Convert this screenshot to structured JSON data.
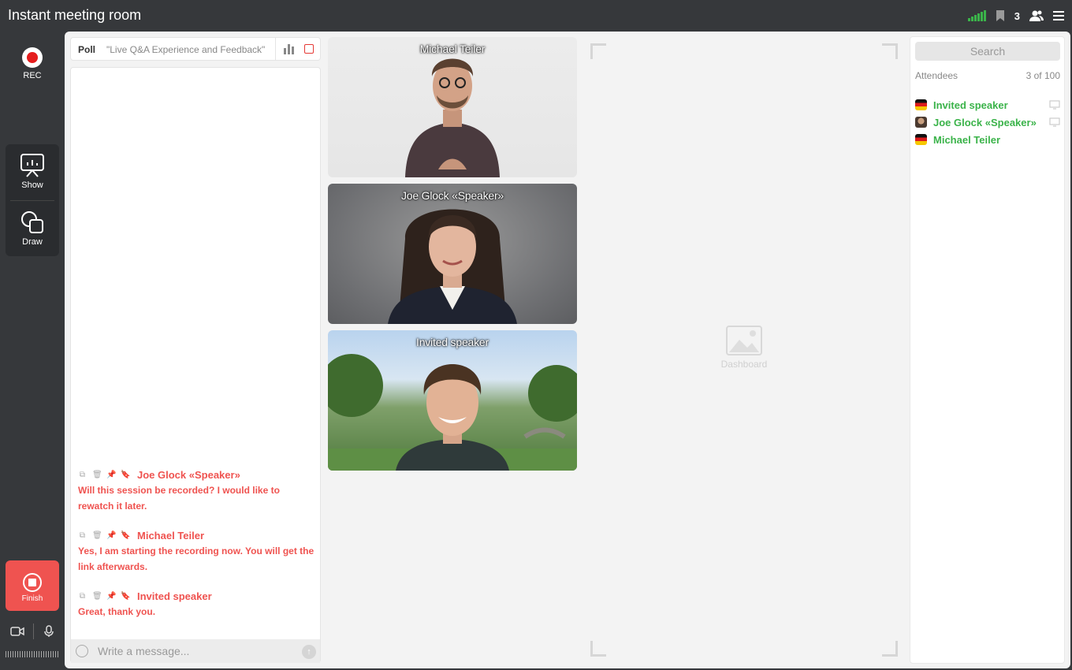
{
  "app": {
    "title": "Instant meeting room"
  },
  "topbar": {
    "participant_count": "3",
    "signal_color": "#3bb34a"
  },
  "rail": {
    "rec_label": "REC",
    "show_label": "Show",
    "draw_label": "Draw",
    "finish_label": "Finish"
  },
  "poll": {
    "label": "Poll",
    "name": "\"Live Q&A Experience and Feedback\""
  },
  "chat": {
    "messages": [
      {
        "author": "Joe Glock «Speaker»",
        "text": "Will this session be recorded? I would like to rewatch it later."
      },
      {
        "author": "Michael Teiler",
        "text": "Yes, I am starting the recording now. You will get the link afterwards."
      },
      {
        "author": "Invited speaker",
        "text": "Great, thank you."
      }
    ],
    "compose_placeholder": "Write a message..."
  },
  "videos": [
    {
      "name": "Michael Teiler"
    },
    {
      "name": "Joe Glock «Speaker»"
    },
    {
      "name": "Invited speaker"
    }
  ],
  "dashboard": {
    "placeholder_label": "Dashboard"
  },
  "attendees": {
    "search_placeholder": "Search",
    "heading": "Attendees",
    "count": "3 of 100",
    "items": [
      {
        "name": "Invited speaker",
        "flag": "germany-flag-icon",
        "screen_icon": "monitor-icon"
      },
      {
        "name": "Joe Glock «Speaker»",
        "flag": "avatar-photo-icon",
        "screen_icon": "monitor-icon"
      },
      {
        "name": "Michael Teiler",
        "flag": "germany-flag-icon"
      }
    ],
    "name_color": "#3bb34a"
  },
  "colors": {
    "accent_red": "#ef5350",
    "rec_red": "#e51d1d",
    "online_green": "#3bb34a"
  }
}
